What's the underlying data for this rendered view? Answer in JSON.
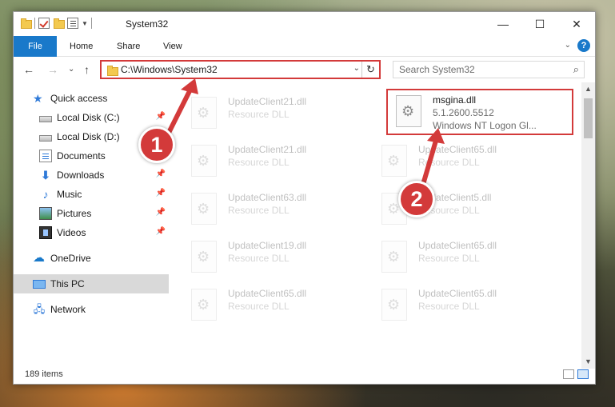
{
  "window": {
    "title": "System32",
    "min_glyph": "—",
    "max_glyph": "☐",
    "close_glyph": "✕"
  },
  "ribbon": {
    "tabs": [
      "File",
      "Home",
      "Share",
      "View"
    ],
    "expand_glyph": "⌄",
    "help_glyph": "?"
  },
  "navigation": {
    "back_glyph": "←",
    "forward_glyph": "→",
    "recent_glyph": "⌄",
    "up_glyph": "↑",
    "address": "C:\\Windows\\System32",
    "address_dropdown_glyph": "⌄",
    "refresh_glyph": "↻",
    "search_placeholder": "Search System32",
    "search_glyph": "⌕"
  },
  "sidebar": {
    "items": [
      {
        "label": "Quick access",
        "icon": "star-icon",
        "pinned": false
      },
      {
        "label": "Local Disk (C:)",
        "icon": "disk-icon",
        "pinned": true
      },
      {
        "label": "Local Disk (D:)",
        "icon": "disk-icon",
        "pinned": false
      },
      {
        "label": "Documents",
        "icon": "documents-icon",
        "pinned": true
      },
      {
        "label": "Downloads",
        "icon": "download-icon",
        "pinned": true
      },
      {
        "label": "Music",
        "icon": "music-icon",
        "pinned": true
      },
      {
        "label": "Pictures",
        "icon": "pictures-icon",
        "pinned": true
      },
      {
        "label": "Videos",
        "icon": "videos-icon",
        "pinned": true
      },
      {
        "label": "OneDrive",
        "icon": "cloud-icon",
        "pinned": false
      },
      {
        "label": "This PC",
        "icon": "computer-icon",
        "pinned": false,
        "selected": true
      },
      {
        "label": "Network",
        "icon": "network-icon",
        "pinned": false
      }
    ]
  },
  "files": {
    "left_column": [
      {
        "name": "UpdateClient21.dll",
        "type": "Resource DLL"
      },
      {
        "name": "UpdateClient21.dll",
        "type": "Resource DLL"
      },
      {
        "name": "UpdateClient63.dll",
        "type": "Resource DLL"
      },
      {
        "name": "UpdateClient19.dll",
        "type": "Resource DLL"
      },
      {
        "name": "UpdateClient65.dll",
        "type": "Resource DLL"
      }
    ],
    "right_column": [
      {
        "name": "msgina.dll",
        "version": "5.1.2600.5512",
        "description": "Windows NT Logon Gl...",
        "highlighted": true
      },
      {
        "name": "UpdateClient65.dll",
        "type": "Resource DLL"
      },
      {
        "name": "UpdateClient5.dll",
        "type": "Resource DLL"
      },
      {
        "name": "UpdateClient65.dll",
        "type": "Resource DLL"
      },
      {
        "name": "UpdateClient65.dll",
        "type": "Resource DLL"
      }
    ]
  },
  "status": {
    "item_count": "189 items"
  },
  "callouts": [
    {
      "number": "1"
    },
    {
      "number": "2"
    }
  ],
  "colors": {
    "accent": "#1979ca",
    "callout": "#d33a3a",
    "selection": "#d9d9d9"
  }
}
